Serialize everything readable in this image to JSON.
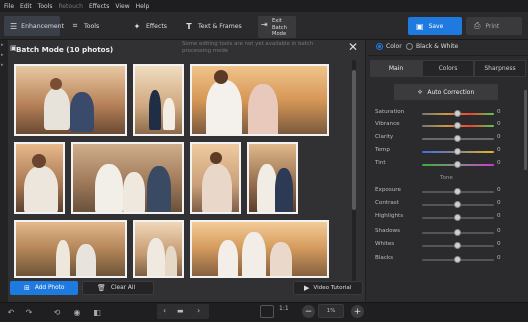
{
  "menu": {
    "items": [
      "File",
      "Edit",
      "Tools",
      "Retouch",
      "Effects",
      "View",
      "Help"
    ],
    "disabled": [
      "Retouch"
    ]
  },
  "toolbar": {
    "tabs": [
      {
        "label": "Enhancement",
        "icon": "sliders-icon",
        "active": true
      },
      {
        "label": "Tools",
        "icon": "crop-icon",
        "active": false
      },
      {
        "label": "Effects",
        "icon": "magic-wand-icon",
        "active": false
      },
      {
        "label": "Text & Frames",
        "icon": "text-icon",
        "active": false
      }
    ],
    "exit_label_line1": "Exit",
    "exit_label_line2": "Batch Mode",
    "save_label": "Save",
    "print_label": "Print"
  },
  "dialog": {
    "title": "Batch Mode (10 photos)",
    "note": "Some editing tools are not yet available in batch processing mode",
    "photo_count": 10,
    "add_photo_label": "Add Photo",
    "clear_all_label": "Clear All",
    "video_tutorial_label": "Video Tutorial"
  },
  "statusbar": {
    "zoom_1to1": "1:1",
    "zoom_value": "1%"
  },
  "right_panel": {
    "color_mode": {
      "color_label": "Color",
      "bw_label": "Black & White",
      "selected": "Color"
    },
    "tabs": [
      {
        "label": "Main",
        "active": true
      },
      {
        "label": "Colors",
        "active": false
      },
      {
        "label": "Sharpness",
        "active": false
      }
    ],
    "auto_correction_label": "Auto Correction",
    "color_sliders": [
      {
        "label": "Saturation",
        "value": "0",
        "level": 0.5
      },
      {
        "label": "Vibrance",
        "value": "0",
        "level": 0.5
      },
      {
        "label": "Clarity",
        "value": "0",
        "level": 0.5
      },
      {
        "label": "Temp",
        "value": "0",
        "level": 0.5
      },
      {
        "label": "Tint",
        "value": "0",
        "level": 0.5
      }
    ],
    "tone_header": "Tone",
    "tone_sliders": [
      {
        "label": "Exposure",
        "value": "0",
        "level": 0.5
      },
      {
        "label": "Contrast",
        "value": "0",
        "level": 0.5
      },
      {
        "label": "Highlights",
        "value": "0",
        "level": 0.5
      },
      {
        "label": "Shadows",
        "value": "0",
        "level": 0.5
      },
      {
        "label": "Whites",
        "value": "0",
        "level": 0.5
      },
      {
        "label": "Blacks",
        "value": "0",
        "level": 0.5
      }
    ]
  },
  "colors": {
    "accent": "#1f7ae0",
    "panel_bg": "#2b2b2d",
    "dialog_bg": "#313133"
  }
}
